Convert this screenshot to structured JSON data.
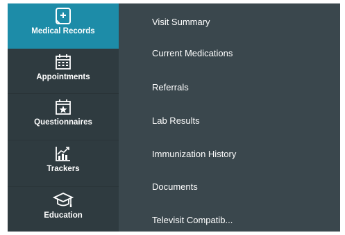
{
  "sidebar": {
    "items": [
      {
        "label": "Medical Records",
        "icon": "medical-records-icon",
        "active": true
      },
      {
        "label": "Appointments",
        "icon": "calendar-icon",
        "active": false
      },
      {
        "label": "Questionnaires",
        "icon": "calendar-star-icon",
        "active": false
      },
      {
        "label": "Trackers",
        "icon": "chart-icon",
        "active": false
      },
      {
        "label": "Education",
        "icon": "graduation-cap-icon",
        "active": false
      }
    ]
  },
  "submenu": {
    "items": [
      {
        "label": "Visit Summary"
      },
      {
        "label": "Current Medications"
      },
      {
        "label": "Referrals"
      },
      {
        "label": "Lab Results"
      },
      {
        "label": "Immunization History"
      },
      {
        "label": "Documents"
      },
      {
        "label": "Televisit Compatib..."
      }
    ]
  },
  "colors": {
    "active": "#1d8ca8",
    "sidebar_bg": "#2f3b40",
    "menu_bg": "#3a474d",
    "text": "#ffffff"
  }
}
